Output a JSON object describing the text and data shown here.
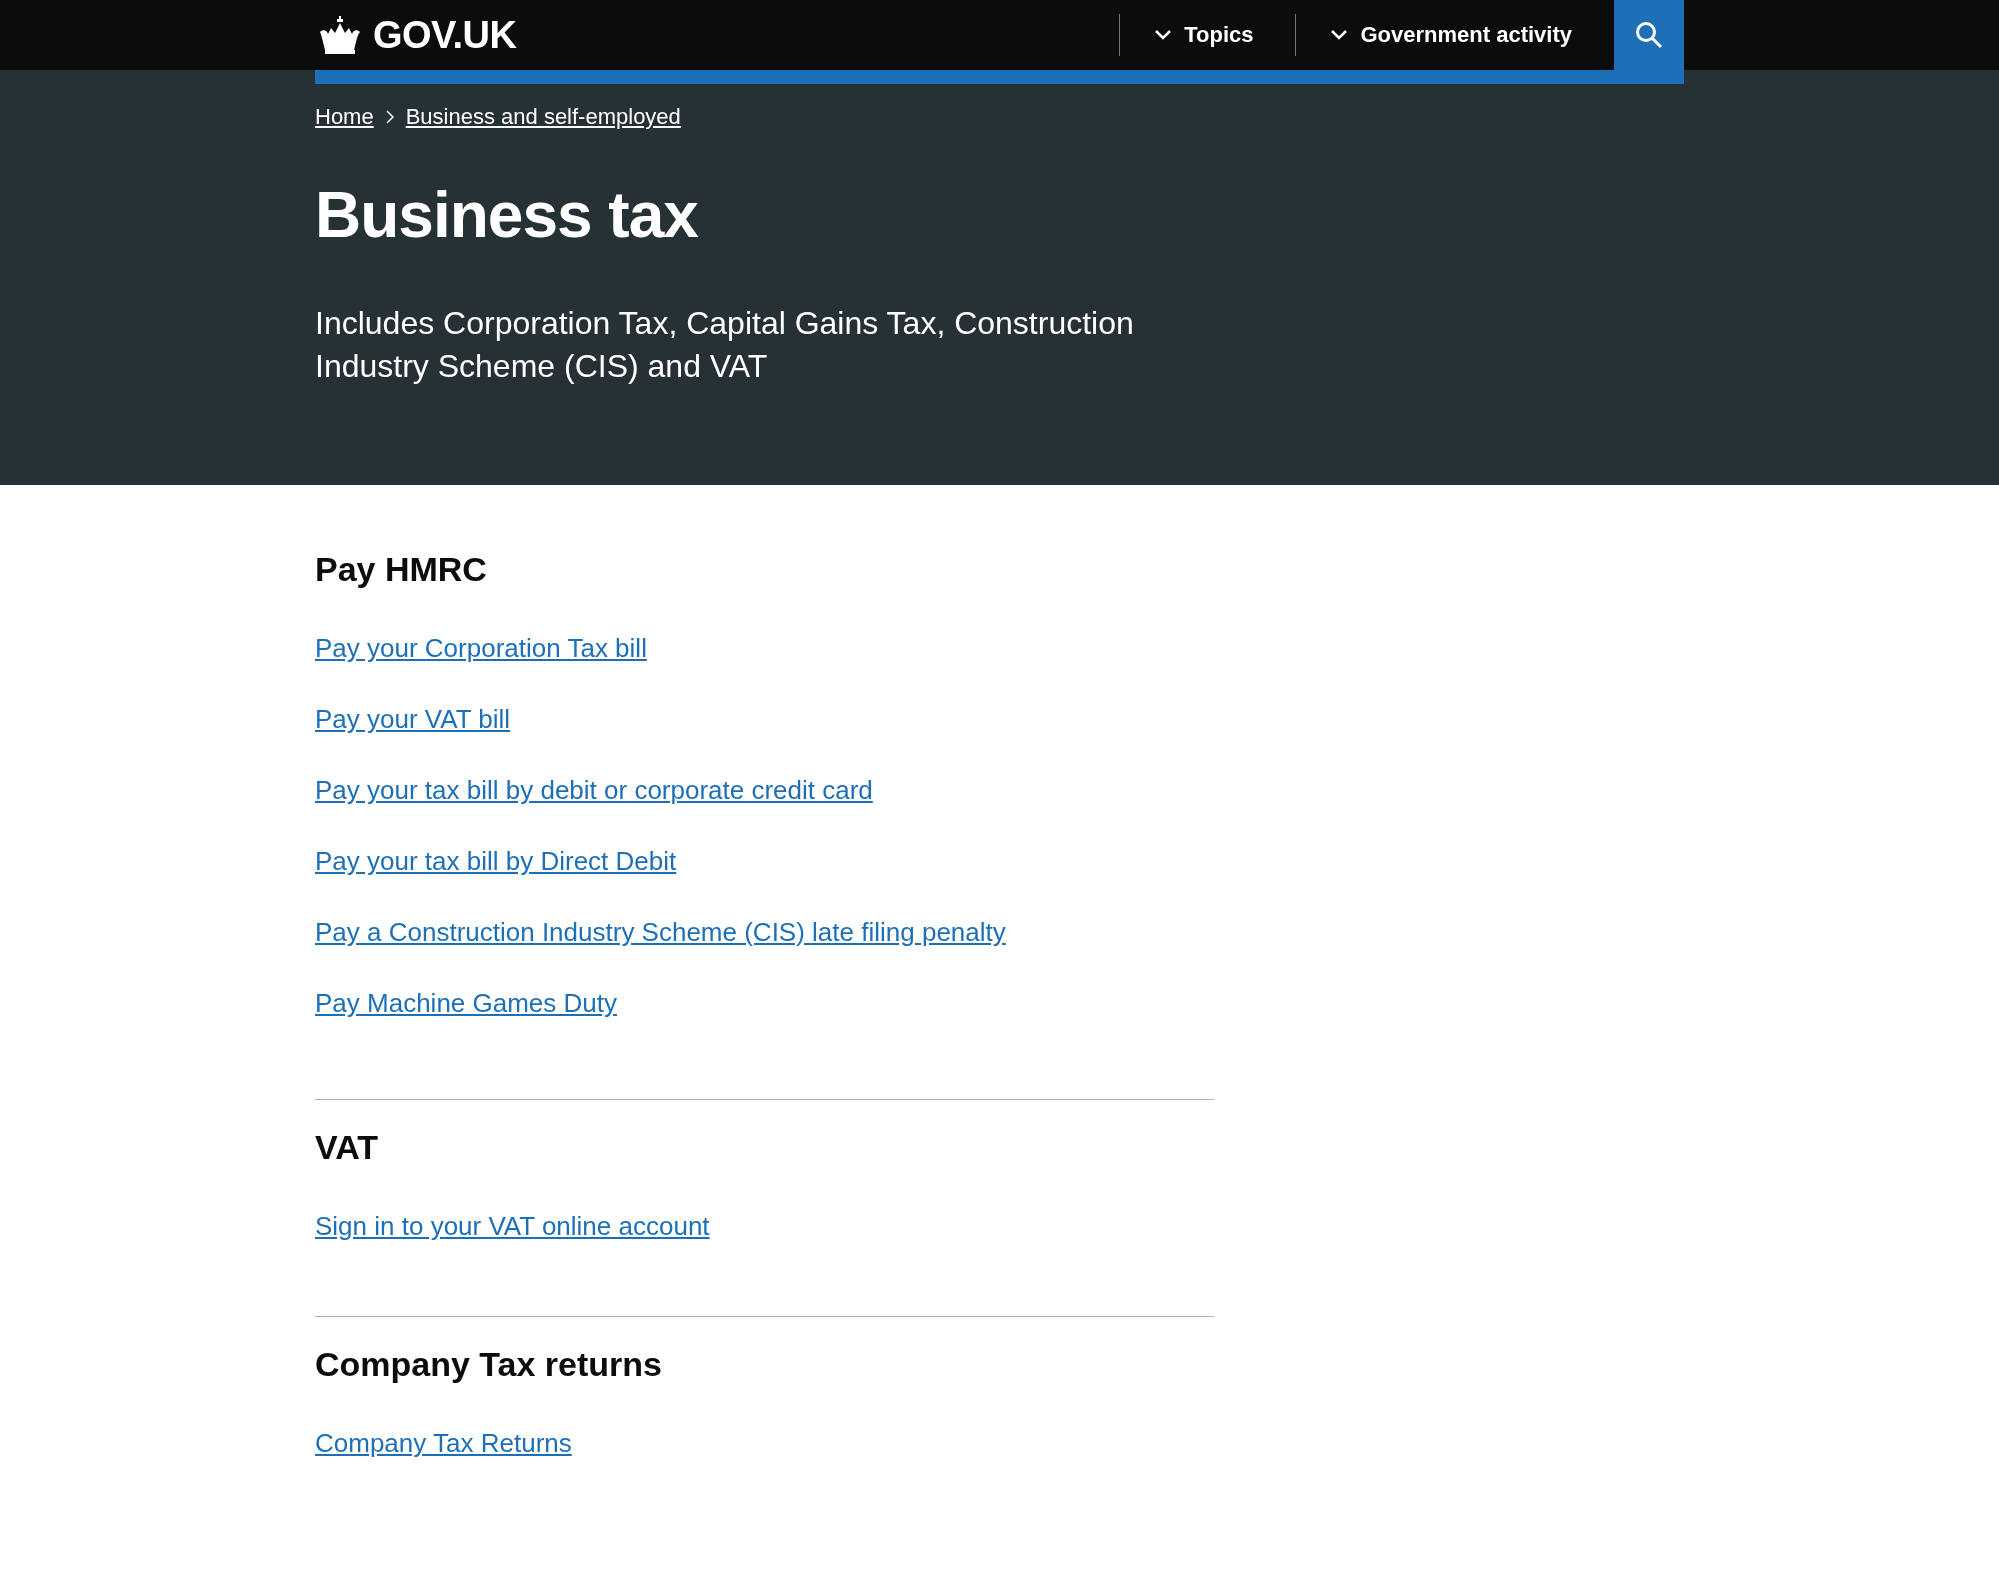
{
  "header": {
    "logo": "GOV.UK",
    "nav": [
      {
        "label": "Topics"
      },
      {
        "label": "Government activity"
      }
    ]
  },
  "breadcrumbs": [
    {
      "label": "Home"
    },
    {
      "label": "Business and self-employed"
    }
  ],
  "title": "Business tax",
  "description": "Includes Corporation Tax, Capital Gains Tax, Construction Industry Scheme (CIS) and VAT",
  "sections": [
    {
      "heading": "Pay HMRC",
      "links": [
        "Pay your Corporation Tax bill",
        "Pay your VAT bill",
        "Pay your tax bill by debit or corporate credit card",
        "Pay your tax bill by Direct Debit",
        "Pay a Construction Industry Scheme (CIS) late filing penalty",
        "Pay Machine Games Duty"
      ]
    },
    {
      "heading": "VAT",
      "links": [
        "Sign in to your VAT online account"
      ]
    },
    {
      "heading": "Company Tax returns",
      "links": [
        "Company Tax Returns"
      ]
    }
  ]
}
